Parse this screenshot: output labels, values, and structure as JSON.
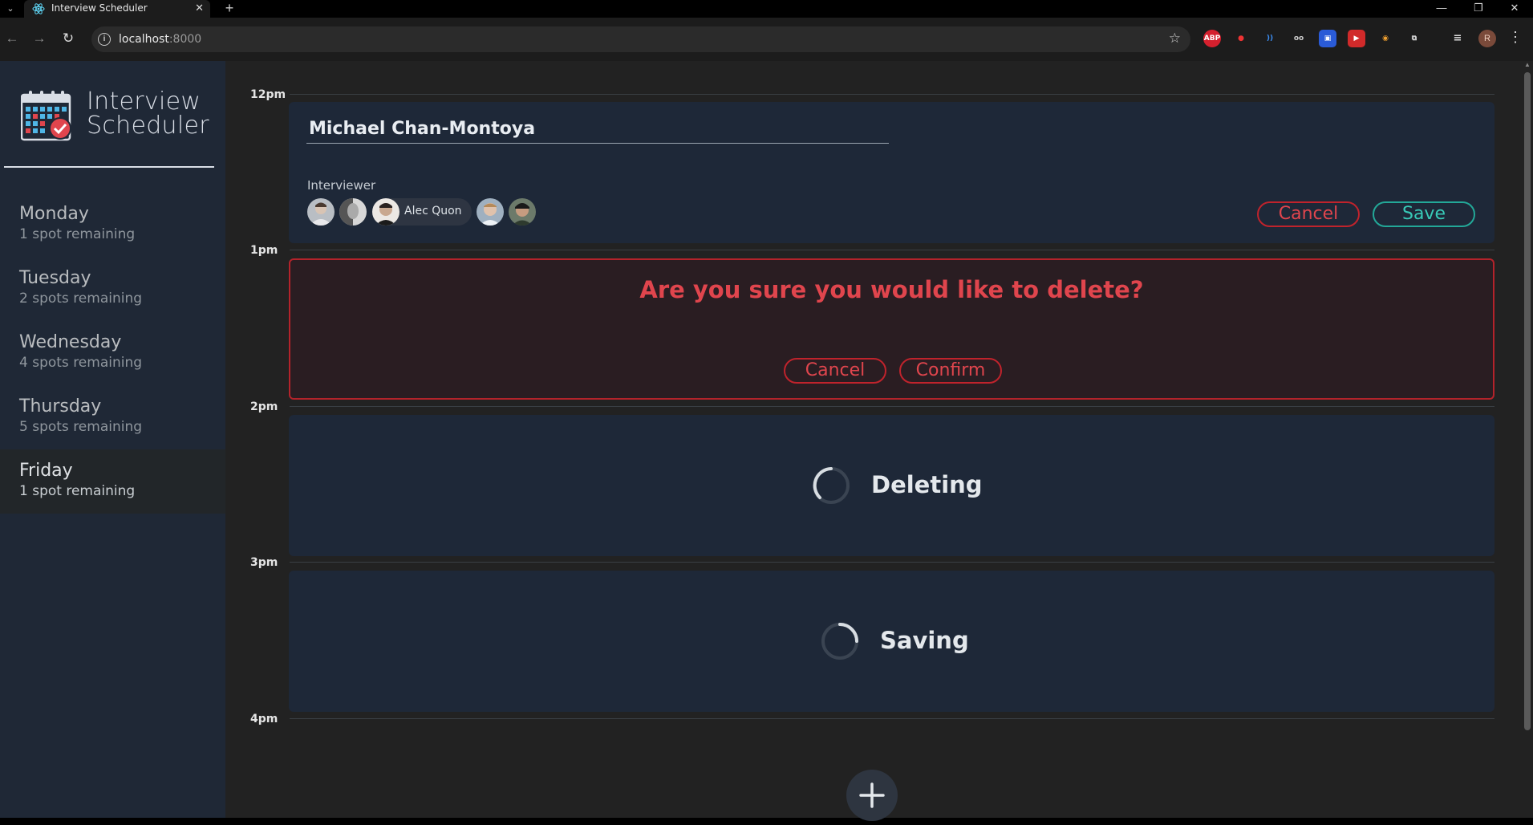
{
  "browser": {
    "tab_title": "Interview Scheduler",
    "tab_close": "✕",
    "new_tab": "+",
    "url_host": "localhost",
    "url_port": ":8000",
    "profile_initial": "R",
    "extensions": [
      "ABP",
      "●",
      "))",
      "oo",
      "▣",
      "▶",
      "◉",
      "⧉"
    ]
  },
  "app": {
    "title_line1": "Interview",
    "title_line2": "Scheduler"
  },
  "sidebar": {
    "days": [
      {
        "name": "Monday",
        "spots": "1 spot remaining"
      },
      {
        "name": "Tuesday",
        "spots": "2 spots remaining"
      },
      {
        "name": "Wednesday",
        "spots": "4 spots remaining"
      },
      {
        "name": "Thursday",
        "spots": "5 spots remaining"
      },
      {
        "name": "Friday",
        "spots": "1 spot remaining",
        "selected": true
      }
    ]
  },
  "schedule": {
    "hours": [
      "12pm",
      "1pm",
      "2pm",
      "3pm",
      "4pm"
    ],
    "form": {
      "student_name": "Michael Chan-Montoya",
      "interviewer_label": "Interviewer",
      "selected_interviewer": "Alec Quon",
      "cancel_label": "Cancel",
      "save_label": "Save"
    },
    "confirm": {
      "message": "Are you sure you would like to delete?",
      "cancel_label": "Cancel",
      "confirm_label": "Confirm"
    },
    "deleting": {
      "message": "Deleting"
    },
    "saving": {
      "message": "Saving"
    }
  },
  "colors": {
    "sidebar_bg": "#1f2836",
    "appointment_bg": "#1e2838",
    "danger": "#e0454d",
    "confirm": "#38c9b7"
  }
}
